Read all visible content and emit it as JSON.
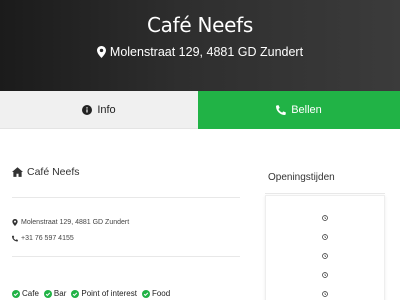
{
  "header": {
    "title": "Café Neefs",
    "address": "Molenstraat 129, 4881 GD Zundert",
    "address_icon": "map-marker-icon"
  },
  "tabs": [
    {
      "label": "Info",
      "icon": "info-circle-icon",
      "active": false
    },
    {
      "label": "Bellen",
      "icon": "phone-icon",
      "active": true
    }
  ],
  "colors": {
    "accent": "#21b346",
    "hero": "#2e2e2e"
  },
  "details": {
    "name": "Café Neefs",
    "name_icon": "home-icon",
    "address": "Molenstraat 129, 4881 GD Zundert",
    "phone": "+31 76 597 4155"
  },
  "tags": [
    "Cafe",
    "Bar",
    "Point of interest",
    "Food"
  ],
  "hours": {
    "title": "Openingstijden",
    "rows": [
      "",
      "",
      "",
      "",
      ""
    ]
  }
}
